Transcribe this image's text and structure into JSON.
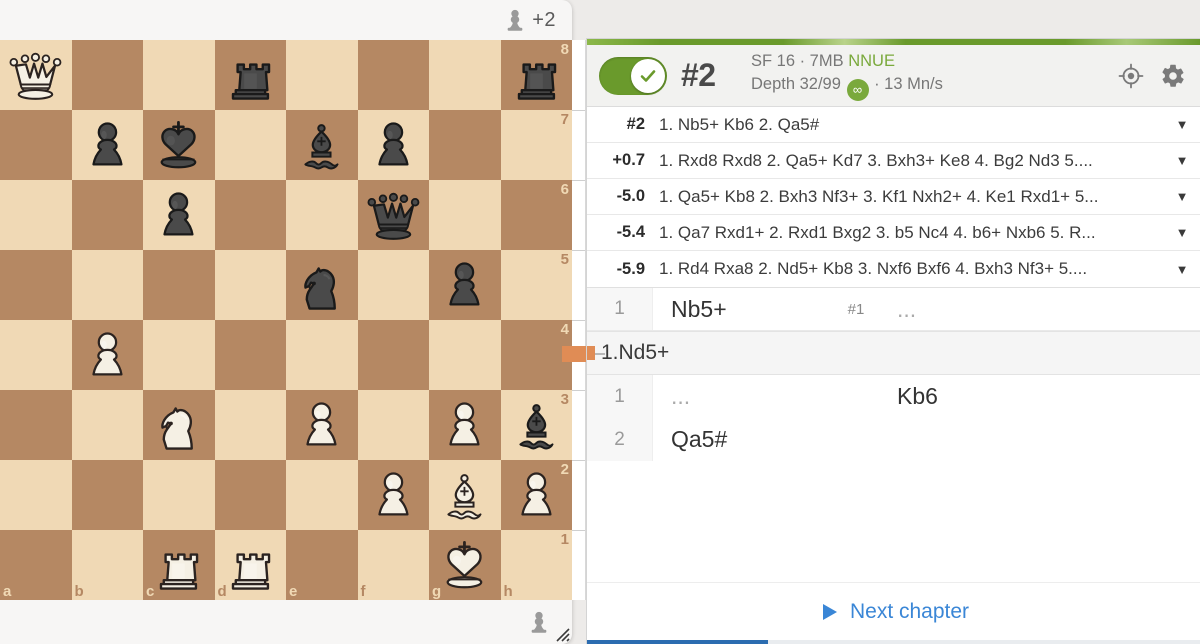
{
  "board": {
    "orientation": "white",
    "files": [
      "a",
      "b",
      "c",
      "d",
      "e",
      "f",
      "g",
      "h"
    ],
    "ranks": [
      "8",
      "7",
      "6",
      "5",
      "4",
      "3",
      "2",
      "1"
    ],
    "light_color": "#f0d9b5",
    "dark_color": "#b58863",
    "pieces": {
      "a8": "white-queen",
      "d8": "black-rook",
      "h8": "black-rook",
      "b7": "black-pawn",
      "c7": "black-king",
      "e7": "black-bishop",
      "f7": "black-pawn",
      "c6": "black-pawn",
      "f6": "black-queen",
      "e5": "black-knight",
      "g5": "black-pawn",
      "b4": "white-pawn",
      "c3": "white-knight",
      "e3": "white-pawn",
      "g3": "white-pawn",
      "h3": "black-bishop",
      "f2": "white-pawn",
      "g2": "white-bishop",
      "h2": "white-pawn",
      "c1": "white-rook",
      "d1": "white-rook",
      "g1": "white-king"
    }
  },
  "players": {
    "top": {
      "material_icon": "pawn-icon",
      "material_advantage": "+2"
    },
    "bottom": {
      "material_icon": "pawn-icon",
      "material_advantage": ""
    }
  },
  "eval_bar": {
    "marker_color": "#e08c55",
    "marker_position_pct": 56
  },
  "engine": {
    "enabled": true,
    "toggle_icon": "check-icon",
    "score": "#2",
    "name_line": "SF 16 · 7MB",
    "nnue_label": "NNUE",
    "depth_line_prefix": "Depth 32/99",
    "infinity_glyph": "∞",
    "speed": "· 13 Mn/s",
    "icons": {
      "target": "crosshair-icon",
      "settings": "gear-icon"
    },
    "accent_green": "#7aa93c"
  },
  "pv_lines": [
    {
      "eval": "#2",
      "moves": "1. Nb5+ Kb6 2. Qa5#",
      "caret": "▼"
    },
    {
      "eval": "+0.7",
      "moves": "1. Rxd8 Rxd8 2. Qa5+ Kd7 3. Bxh3+ Ke8 4. Bg2 Nd3 5....",
      "caret": "▼"
    },
    {
      "eval": "-5.0",
      "moves": "1. Qa5+ Kb8 2. Bxh3 Nf3+ 3. Kf1 Nxh2+ 4. Ke1 Rxd1+ 5...",
      "caret": "▼"
    },
    {
      "eval": "-5.4",
      "moves": "1. Qa7 Rxd1+ 2. Rxd1 Bxg2 3. b5 Nc4 4. b6+ Nxb6 5. R...",
      "caret": "▼"
    },
    {
      "eval": "-5.9",
      "moves": "1. Rd4 Rxa8 2. Nd5+ Kb8 3. Nxf6 Bxf6 4. Bxh3 Nf3+ 5....",
      "caret": "▼"
    }
  ],
  "move_list": {
    "rows": [
      {
        "kind": "move",
        "num": "1",
        "white": "Nb5+",
        "glyph": "#1",
        "black": "...",
        "black_muted": true
      },
      {
        "kind": "variation",
        "text": "1.Nd5+"
      },
      {
        "kind": "move",
        "num": "1",
        "white": "...",
        "white_muted": true,
        "glyph": "",
        "black": "Kb6"
      },
      {
        "kind": "move",
        "num": "2",
        "white": "Qa5#",
        "glyph": "",
        "black": ""
      }
    ]
  },
  "footer": {
    "next_chapter_label": "Next chapter",
    "play_icon": "play-icon",
    "link_color": "#3a86d6",
    "progress_pct": 29.5
  }
}
